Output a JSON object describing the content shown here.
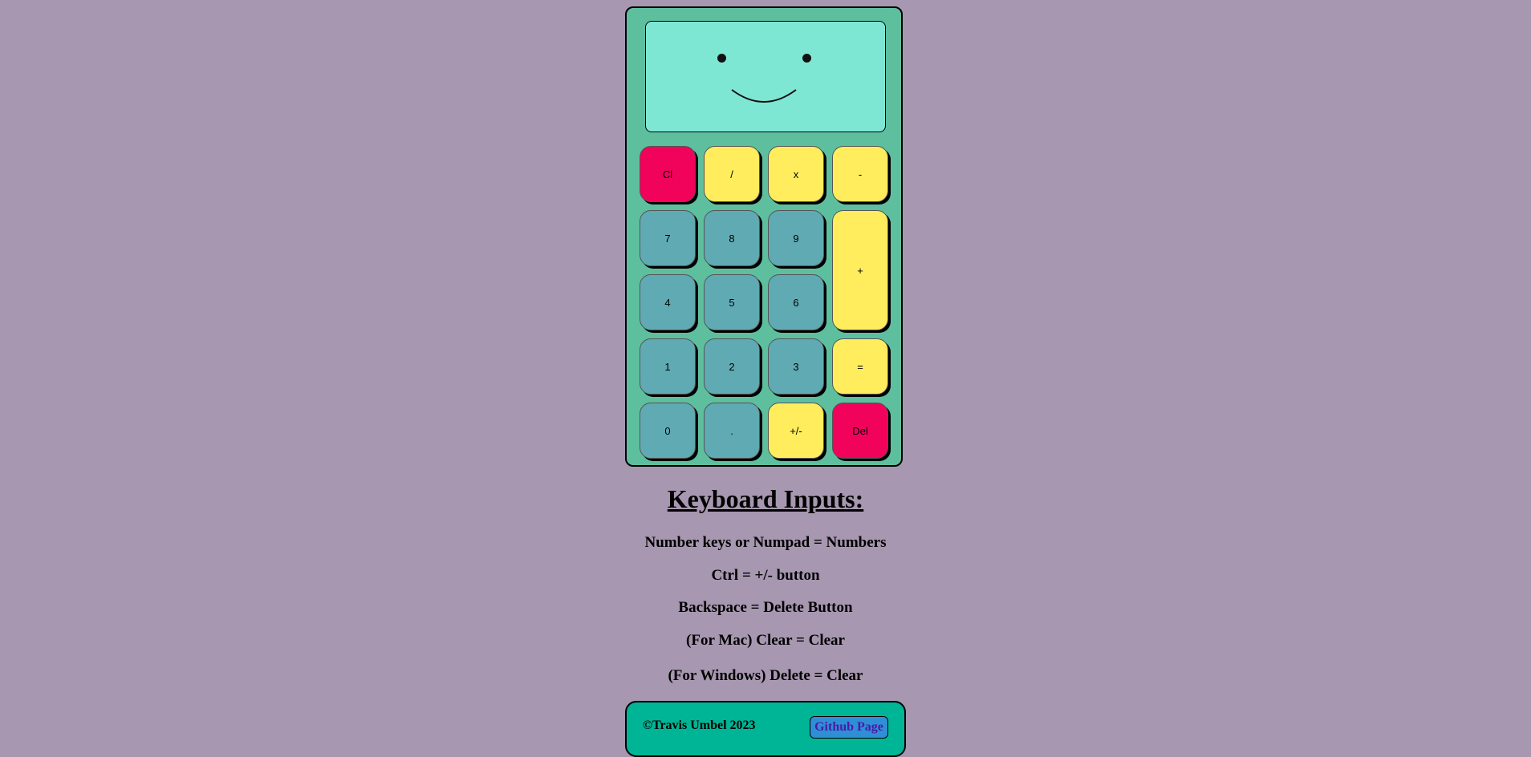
{
  "calculator": {
    "buttons": {
      "clear": "Cl",
      "divide": "/",
      "multiply": "x",
      "subtract": "-",
      "seven": "7",
      "eight": "8",
      "nine": "9",
      "add": "+",
      "four": "4",
      "five": "5",
      "six": "6",
      "one": "1",
      "two": "2",
      "three": "3",
      "equals": "=",
      "zero": "0",
      "decimal": ".",
      "sign": "+/-",
      "delete": "Del"
    }
  },
  "keyboard": {
    "title": "Keyboard Inputs:",
    "lines": [
      "Number keys or Numpad = Numbers",
      "Ctrl = +/- button",
      "Backspace = Delete Button",
      "(For Mac) Clear = Clear",
      "(For Windows) Delete = Clear"
    ]
  },
  "footer": {
    "copyright": "©Travis Umbel 2023",
    "github_label": "Github Page"
  },
  "colors": {
    "background": "#a797b0",
    "calculator_body": "#5ebf9f",
    "screen": "#7ee7d4",
    "red_button": "#f2035b",
    "yellow_button": "#ffed5e",
    "teal_button": "#60aab4",
    "footer": "#00b596",
    "link_button": "#2f8fd6"
  }
}
